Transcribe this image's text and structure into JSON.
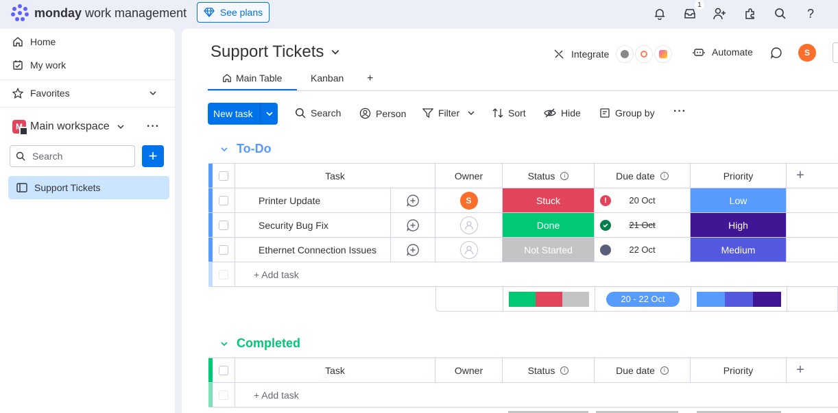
{
  "app": {
    "brand_bold": "monday",
    "brand_rest": " work management",
    "see_plans": "See plans",
    "inbox_badge": "1"
  },
  "sidebar": {
    "home": "Home",
    "my_work": "My work",
    "favorites": "Favorites",
    "workspace_initial": "M",
    "workspace_name": "Main workspace",
    "search_placeholder": "Search",
    "board_item": "Support Tickets"
  },
  "board": {
    "title": "Support Tickets",
    "integrate": "Integrate",
    "automate": "Automate",
    "user_initial": "S",
    "tabs": [
      {
        "label": "Main Table",
        "active": true
      },
      {
        "label": "Kanban",
        "active": false
      }
    ],
    "tab_add": "+"
  },
  "toolbar": {
    "new_task": "New task",
    "search": "Search",
    "person": "Person",
    "filter": "Filter",
    "sort": "Sort",
    "hide": "Hide",
    "group_by": "Group by",
    "more": "···"
  },
  "columns": {
    "task": "Task",
    "owner": "Owner",
    "status": "Status",
    "due_date": "Due date",
    "priority": "Priority",
    "add": "+"
  },
  "groups": [
    {
      "title": "To-Do",
      "color": "#579bfc",
      "add_task": "+ Add task",
      "rows": [
        {
          "task": "Printer Update",
          "owner": "S",
          "status": "Stuck",
          "status_color": "#e2445c",
          "due": "20 Oct",
          "due_icon": "alert-icon",
          "priority": "Low",
          "priority_color": "#579bfc"
        },
        {
          "task": "Security Bug Fix",
          "owner": "",
          "status": "Done",
          "status_color": "#00c875",
          "due": "21 Oct",
          "due_icon": "check-icon",
          "priority": "High",
          "priority_color": "#401694"
        },
        {
          "task": "Ethernet Connection Issues",
          "owner": "",
          "status": "Not Started",
          "status_color": "#c4c4c4",
          "due": "22 Oct",
          "due_icon": "dot-icon",
          "priority": "Medium",
          "priority_color": "#5559df"
        }
      ],
      "summary": {
        "date_range": "20 - 22 Oct"
      }
    },
    {
      "title": "Completed",
      "color": "#00c875",
      "add_task": "+ Add task",
      "rows": []
    }
  ]
}
